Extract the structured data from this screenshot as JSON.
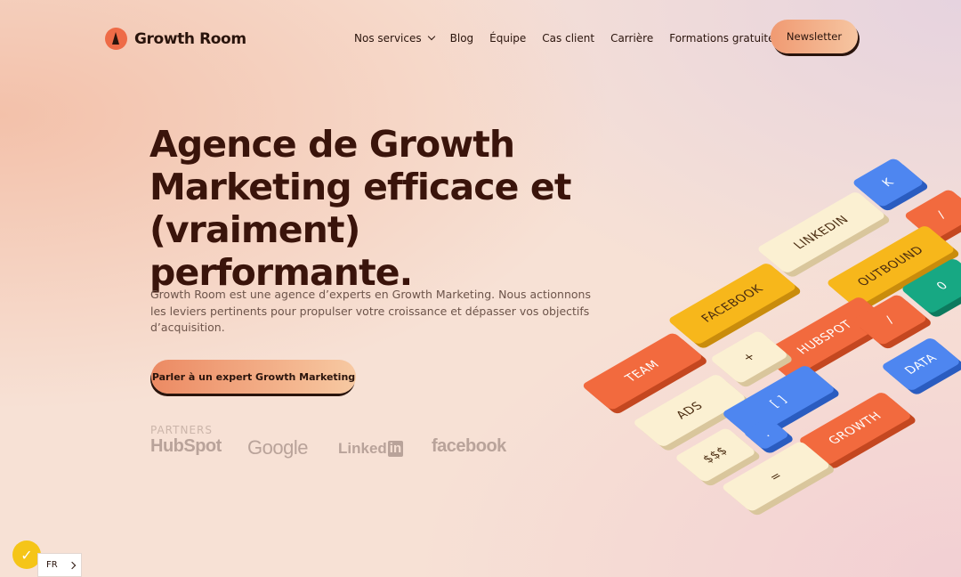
{
  "header": {
    "logo_text": "Growth Room",
    "nav": [
      {
        "label": "Nos services"
      },
      {
        "label": "Blog"
      },
      {
        "label": "Équipe"
      },
      {
        "label": "Cas client"
      },
      {
        "label": "Carrière"
      },
      {
        "label": "Formations gratuites"
      }
    ],
    "newsletter_label": "Newsletter"
  },
  "hero": {
    "title_line1": "Agence de Growth",
    "title_line2": "Marketing efficace et",
    "title_line3": "(vraiment) performante.",
    "description": "Growth Room est une agence d’experts en Growth Marketing. Nous actionnons les leviers pertinents pour propulser votre croissance et dépasser vos objectifs d’acquisition.",
    "cta_label": "Parler à un expert Growth Marketing"
  },
  "partners": {
    "label": "PARTNERS",
    "logos": [
      "HubSpot",
      "Google",
      "Linked",
      "in",
      "facebook"
    ]
  },
  "keyboard": {
    "keys": [
      "K",
      "/",
      "LINKEDIN",
      "OUTBOUND",
      "0",
      "FACEBOOK",
      "HUBSPOT",
      "/",
      "TEAM",
      "+",
      "DATA",
      "ADS",
      "[ ]",
      ".",
      "GROWTH",
      "$$$",
      "="
    ]
  },
  "widgets": {
    "language": "FR"
  },
  "colors": {
    "accent": "#ee6b47",
    "text_dark": "#2a140c",
    "key_orange": "#f26a3e",
    "key_yellow": "#f7b71b",
    "key_blue": "#4e86f0",
    "key_green": "#17a883",
    "key_cream": "#fbf0d2"
  }
}
